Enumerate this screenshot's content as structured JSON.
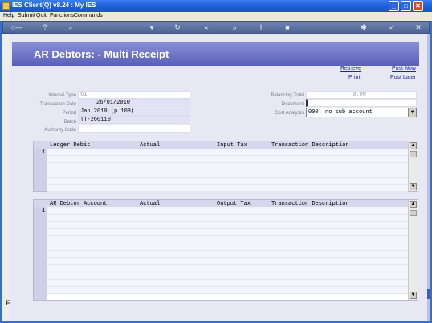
{
  "window": {
    "title": "IES Client(Q) v8.24 : My IES",
    "buttons": {
      "min": "_",
      "max": "□",
      "close": "✕"
    }
  },
  "menu": [
    {
      "label": "Help"
    },
    {
      "label": "Submit"
    },
    {
      "label": "Quit"
    },
    {
      "label": "Functions"
    },
    {
      "label": "Commands"
    }
  ],
  "toolbar": {
    "icons": [
      "key-icon",
      "help-icon",
      "search-icon",
      "heart-icon",
      "refresh-icon",
      "rewind-icon",
      "fast-forward-icon",
      "text-cursor-icon",
      "stop-icon",
      "settings-icon",
      "check-icon",
      "close-icon"
    ],
    "glyphs": {
      "key": "○—",
      "help": "?",
      "search": "⌕",
      "heart": "♥",
      "refresh": "↻",
      "rewind": "«",
      "forward": "»",
      "cursor": "I",
      "stop": "■",
      "settings": "✱",
      "check": "✓",
      "close": "✕"
    }
  },
  "page": {
    "title": "AR Debtors: - Multi Receipt"
  },
  "actions": {
    "retrieve": "Retrieve",
    "print": "Print",
    "post_now": "Post Now",
    "post_later": "Post Later"
  },
  "form": {
    "internal_type": {
      "label": "Internal Type",
      "value": "61"
    },
    "transaction_date": {
      "label": "Transaction Date",
      "value": "26/01/2010"
    },
    "period": {
      "label": "Period",
      "value": "Jan 2010 (p 108)"
    },
    "batch": {
      "label": "Batch",
      "value": "TT-260110"
    },
    "authority_code": {
      "label": "Authority Code",
      "value": ""
    },
    "balancing_total": {
      "label": "Balancing Total",
      "value": "0.00"
    },
    "document": {
      "label": "Document",
      "value": ""
    },
    "cost_analysis": {
      "label": "Cost Analysis",
      "value": "000: no sub account",
      "arrow": "▼"
    }
  },
  "grid1": {
    "columns": [
      "Ledger Debit",
      "Actual",
      "Input Tax",
      "Transaction Description"
    ],
    "row_numbers": [
      "1"
    ],
    "arrows": {
      "up": "▲",
      "down": "▼"
    }
  },
  "grid2": {
    "columns": [
      "AR Debtor Account",
      "Actual",
      "Output Tax",
      "Transaction Description"
    ],
    "row_numbers": [
      "1"
    ],
    "arrows": {
      "up": "▲",
      "down": "▼"
    }
  },
  "left_strip": {
    "label": "E"
  }
}
